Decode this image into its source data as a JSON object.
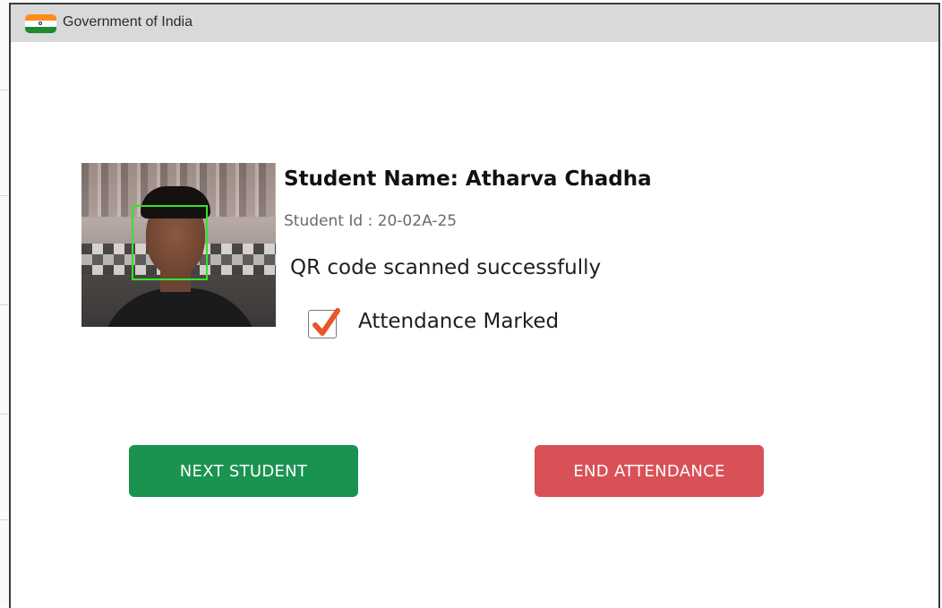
{
  "window": {
    "title": "Government of India",
    "flag_icon": "india-flag-icon"
  },
  "student": {
    "photo_icon": "student-camera-photo",
    "name_text": "Student Name: Atharva Chadha",
    "id_text": "Student Id : 20-02A-25"
  },
  "status": {
    "qr_message": "QR code scanned successfully",
    "attendance_checked": true,
    "attendance_label": "Attendance Marked",
    "check_color": "#e8562a"
  },
  "actions": {
    "next_label": "NEXT STUDENT",
    "end_label": "END ATTENDANCE",
    "next_color": "#1a9351",
    "end_color": "#d85157"
  }
}
